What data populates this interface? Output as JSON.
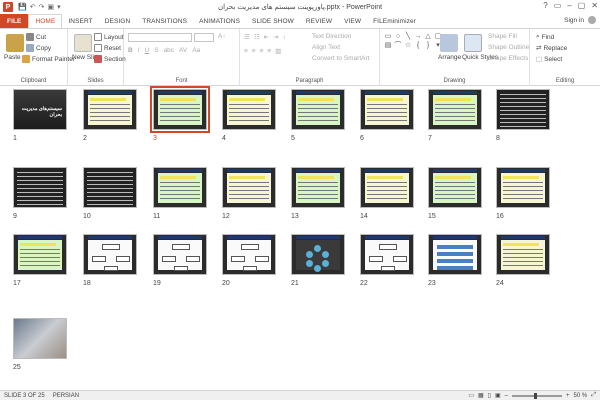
{
  "titlebar": {
    "app_letter": "P",
    "title": "پاورپوینت سیستم های مدیریت بحران.pptx - PowerPoint",
    "controls": [
      "?",
      "▭",
      "–",
      "▢",
      "✕"
    ]
  },
  "tabs": [
    "FILE",
    "HOME",
    "INSERT",
    "DESIGN",
    "TRANSITIONS",
    "ANIMATIONS",
    "SLIDE SHOW",
    "REVIEW",
    "VIEW",
    "FILEminimizer"
  ],
  "active_tab": "HOME",
  "account": {
    "signin": "Sign in"
  },
  "ribbon": {
    "clipboard": {
      "label": "Clipboard",
      "paste": "Paste",
      "cut": "Cut",
      "copy": "Copy",
      "format_painter": "Format Painter"
    },
    "slides": {
      "label": "Slides",
      "new_slide": "New Slide",
      "layout": "Layout",
      "reset": "Reset",
      "section": "Section"
    },
    "font": {
      "label": "Font"
    },
    "paragraph": {
      "label": "Paragraph",
      "text_direction": "Text Direction",
      "align_text": "Align Text",
      "convert_smartart": "Convert to SmartArt"
    },
    "drawing": {
      "label": "Drawing",
      "arrange": "Arrange",
      "quick_styles": "Quick Styles",
      "shape_fill": "Shape Fill",
      "shape_outline": "Shape Outline",
      "shape_effects": "Shape Effects"
    },
    "editing": {
      "label": "Editing",
      "find": "Find",
      "replace": "Replace",
      "select": "Select"
    }
  },
  "slides": [
    {
      "n": "1"
    },
    {
      "n": "2"
    },
    {
      "n": "3"
    },
    {
      "n": "4"
    },
    {
      "n": "5"
    },
    {
      "n": "6"
    },
    {
      "n": "7"
    },
    {
      "n": "8"
    },
    {
      "n": "9"
    },
    {
      "n": "10"
    },
    {
      "n": "11"
    },
    {
      "n": "12"
    },
    {
      "n": "13"
    },
    {
      "n": "14"
    },
    {
      "n": "15"
    },
    {
      "n": "16"
    },
    {
      "n": "17"
    },
    {
      "n": "18"
    },
    {
      "n": "19"
    },
    {
      "n": "20"
    },
    {
      "n": "21"
    },
    {
      "n": "22"
    },
    {
      "n": "23"
    },
    {
      "n": "24"
    },
    {
      "n": "25"
    }
  ],
  "selected_slide": 3,
  "cover_title": "سیستم‌های مدیریت بحران",
  "status": {
    "slide_info": "SLIDE 3 OF 25",
    "language": "PERSIAN",
    "zoom": "50 %"
  },
  "colors": {
    "accent": "#d24726"
  }
}
